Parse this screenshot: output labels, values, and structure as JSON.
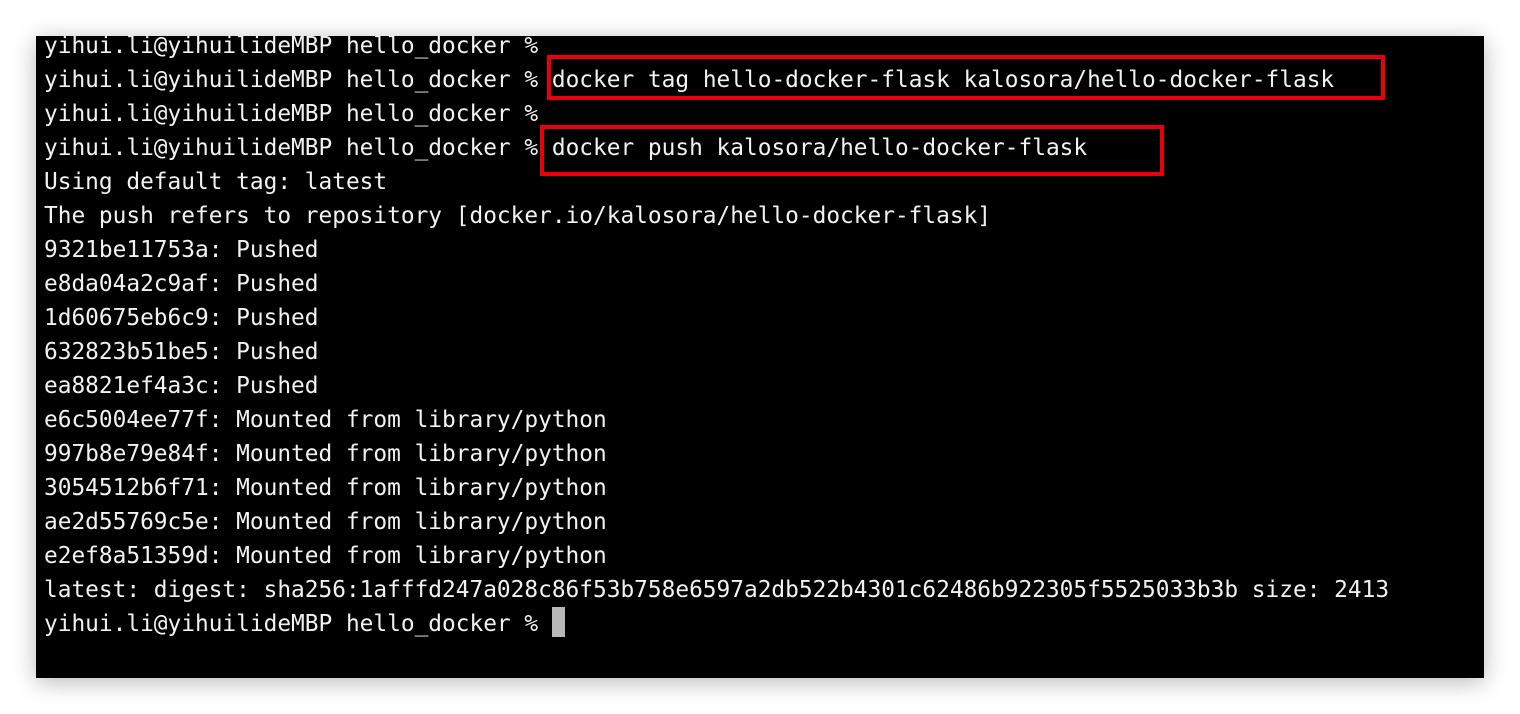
{
  "terminal": {
    "prompt": "yihui.li@yihuilideMBP hello_docker %",
    "commands": {
      "tag": "docker tag hello-docker-flask kalosora/hello-docker-flask",
      "push": "docker push kalosora/hello-docker-flask"
    },
    "output": {
      "default_tag": "Using default tag: latest",
      "push_refers": "The push refers to repository [docker.io/kalosora/hello-docker-flask]",
      "layers": [
        "9321be11753a: Pushed",
        "e8da04a2c9af: Pushed",
        "1d60675eb6c9: Pushed",
        "632823b51be5: Pushed",
        "ea8821ef4a3c: Pushed",
        "e6c5004ee77f: Mounted from library/python",
        "997b8e79e84f: Mounted from library/python",
        "3054512b6f71: Mounted from library/python",
        "ae2d55769c5e: Mounted from library/python",
        "e2ef8a51359d: Mounted from library/python"
      ],
      "digest": "latest: digest: sha256:1afffd247a028c86f53b758e6597a2db522b4301c62486b922305f5525033b3b size: 2413"
    }
  },
  "colors": {
    "background": "#000000",
    "text": "#f2f2f2",
    "highlight": "#e8000b",
    "cursor": "#b8b8b8"
  }
}
